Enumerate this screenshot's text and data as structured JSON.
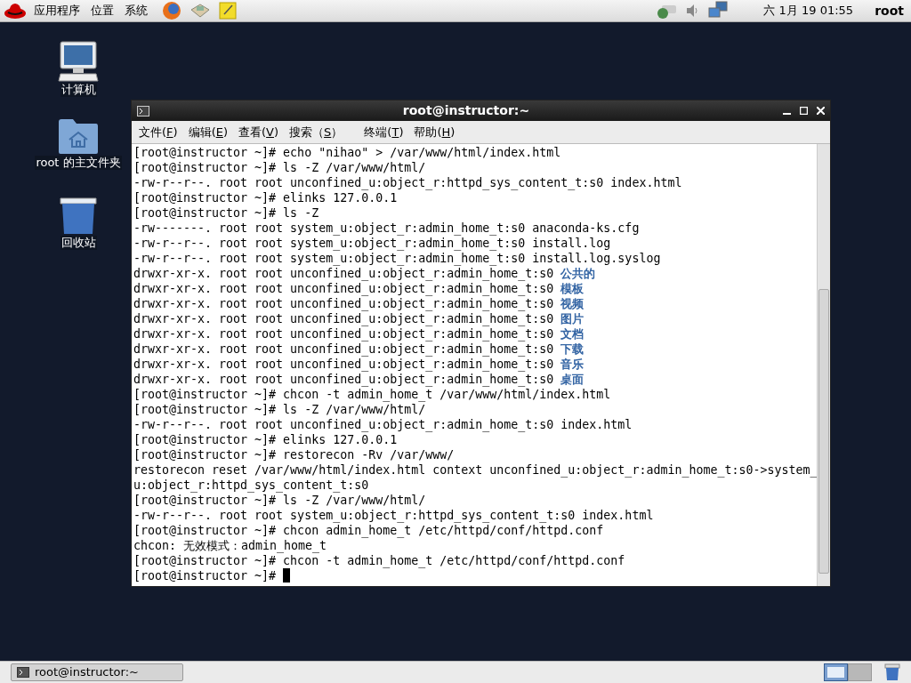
{
  "top_panel": {
    "menus": [
      "应用程序",
      "位置",
      "系统"
    ],
    "clock": "六 1月 19 01:55",
    "user": "root"
  },
  "desktop_icons": [
    {
      "kind": "computer",
      "label": "计算机"
    },
    {
      "kind": "home",
      "label": "root 的主文件夹"
    },
    {
      "kind": "trash",
      "label": "回收站"
    }
  ],
  "terminal": {
    "title": "root@instructor:~",
    "menu": [
      {
        "before": "文件(",
        "key": "F",
        "after": ")"
      },
      {
        "before": "编辑(",
        "key": "E",
        "after": ")"
      },
      {
        "before": "查看(",
        "key": "V",
        "after": ")"
      },
      {
        "before": "搜索（",
        "key": "S",
        "after": "）"
      },
      {
        "before": "终端(",
        "key": "T",
        "after": ")"
      },
      {
        "before": "帮助(",
        "key": "H",
        "after": ")"
      }
    ],
    "lines": [
      {
        "text": "[root@instructor ~]# echo \"nihao\" > /var/www/html/index.html"
      },
      {
        "text": "[root@instructor ~]# ls -Z /var/www/html/"
      },
      {
        "text": "-rw-r--r--. root root unconfined_u:object_r:httpd_sys_content_t:s0 index.html"
      },
      {
        "text": "[root@instructor ~]# elinks 127.0.0.1"
      },
      {
        "text": "[root@instructor ~]# ls -Z"
      },
      {
        "text": "-rw-------. root root system_u:object_r:admin_home_t:s0 anaconda-ks.cfg"
      },
      {
        "text": "-rw-r--r--. root root system_u:object_r:admin_home_t:s0 install.log"
      },
      {
        "text": "-rw-r--r--. root root system_u:object_r:admin_home_t:s0 install.log.syslog"
      },
      {
        "text": "drwxr-xr-x. root root unconfined_u:object_r:admin_home_t:s0 ",
        "dir": "公共的"
      },
      {
        "text": "drwxr-xr-x. root root unconfined_u:object_r:admin_home_t:s0 ",
        "dir": "模板"
      },
      {
        "text": "drwxr-xr-x. root root unconfined_u:object_r:admin_home_t:s0 ",
        "dir": "视频"
      },
      {
        "text": "drwxr-xr-x. root root unconfined_u:object_r:admin_home_t:s0 ",
        "dir": "图片"
      },
      {
        "text": "drwxr-xr-x. root root unconfined_u:object_r:admin_home_t:s0 ",
        "dir": "文档"
      },
      {
        "text": "drwxr-xr-x. root root unconfined_u:object_r:admin_home_t:s0 ",
        "dir": "下载"
      },
      {
        "text": "drwxr-xr-x. root root unconfined_u:object_r:admin_home_t:s0 ",
        "dir": "音乐"
      },
      {
        "text": "drwxr-xr-x. root root unconfined_u:object_r:admin_home_t:s0 ",
        "dir": "桌面"
      },
      {
        "text": "[root@instructor ~]# chcon -t admin_home_t /var/www/html/index.html"
      },
      {
        "text": "[root@instructor ~]# ls -Z /var/www/html/"
      },
      {
        "text": "-rw-r--r--. root root unconfined_u:object_r:admin_home_t:s0 index.html"
      },
      {
        "text": "[root@instructor ~]# elinks 127.0.0.1"
      },
      {
        "text": "[root@instructor ~]# restorecon -Rv /var/www/"
      },
      {
        "text": "restorecon reset /var/www/html/index.html context unconfined_u:object_r:admin_home_t:s0->system_"
      },
      {
        "text": "u:object_r:httpd_sys_content_t:s0"
      },
      {
        "text": "[root@instructor ~]# ls -Z /var/www/html/"
      },
      {
        "text": "-rw-r--r--. root root system_u:object_r:httpd_sys_content_t:s0 index.html"
      },
      {
        "text": "[root@instructor ~]# chcon admin_home_t /etc/httpd/conf/httpd.conf"
      },
      {
        "text": "chcon: 无效模式：admin_home_t"
      },
      {
        "text": "[root@instructor ~]# chcon -t admin_home_t /etc/httpd/conf/httpd.conf"
      },
      {
        "text": "[root@instructor ~]# ",
        "cursor": true
      }
    ]
  },
  "taskbar": {
    "tasks": [
      {
        "label": "root@instructor:~"
      }
    ],
    "workspaces": [
      {
        "selected": true
      },
      {
        "selected": false
      }
    ]
  }
}
